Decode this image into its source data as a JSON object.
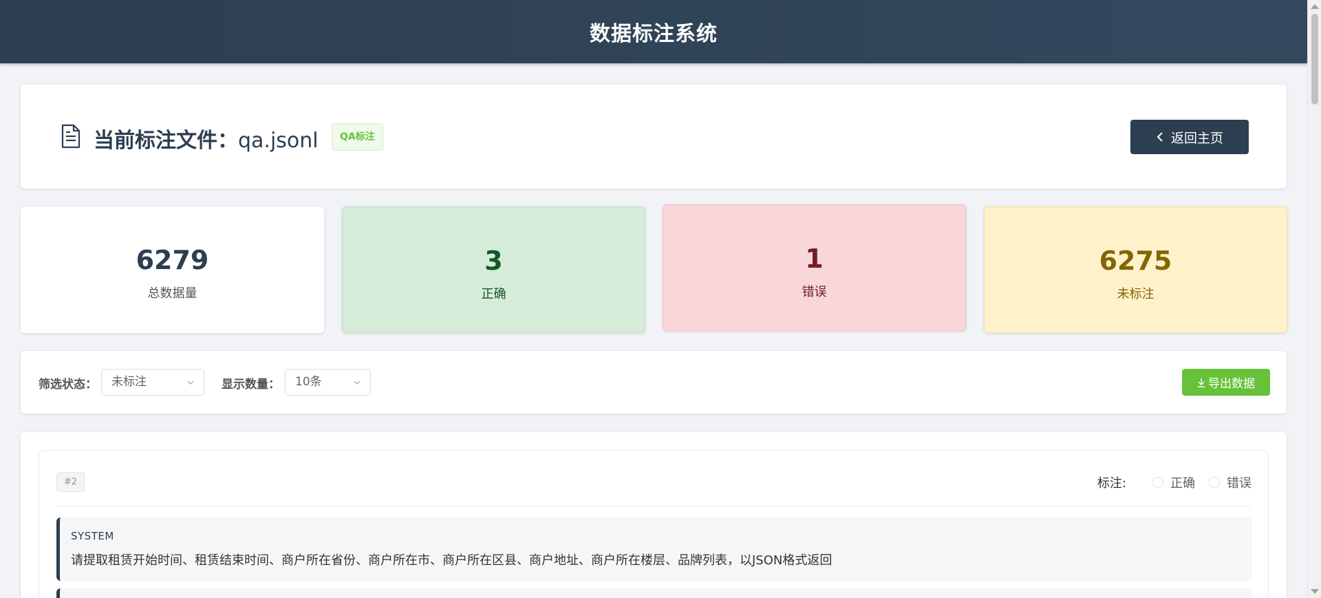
{
  "header": {
    "title": "数据标注系统"
  },
  "file": {
    "title_prefix": "当前标注文件：",
    "filename": "qa.jsonl",
    "tag": "QA标注",
    "back_label": "返回主页"
  },
  "stats": {
    "total": {
      "value": "6279",
      "label": "总数据量"
    },
    "correct": {
      "value": "3",
      "label": "正确"
    },
    "wrong": {
      "value": "1",
      "label": "错误"
    },
    "unlabeled": {
      "value": "6275",
      "label": "未标注"
    }
  },
  "filters": {
    "status_label": "筛选状态",
    "status_value": "未标注",
    "count_label": "显示数量",
    "count_value": "10条",
    "export_label": "导出数据"
  },
  "item": {
    "index": "#2",
    "annotate_label": "标注:",
    "option_correct": "正确",
    "option_wrong": "错误",
    "messages": [
      {
        "role": "SYSTEM",
        "content": "请提取租赁开始时间、租赁结束时间、商户所在省份、商户所在市、商户所在区县、商户地址、商户所在楼层、品牌列表，以JSON格式返回"
      }
    ]
  },
  "colors": {
    "header_bg": "#2c3e50",
    "primary": "#2c3e50",
    "success": "#67c23a",
    "correct_bg": "#d4ecd9",
    "wrong_bg": "#f8d6da",
    "unlabeled_bg": "#fff1c9"
  }
}
